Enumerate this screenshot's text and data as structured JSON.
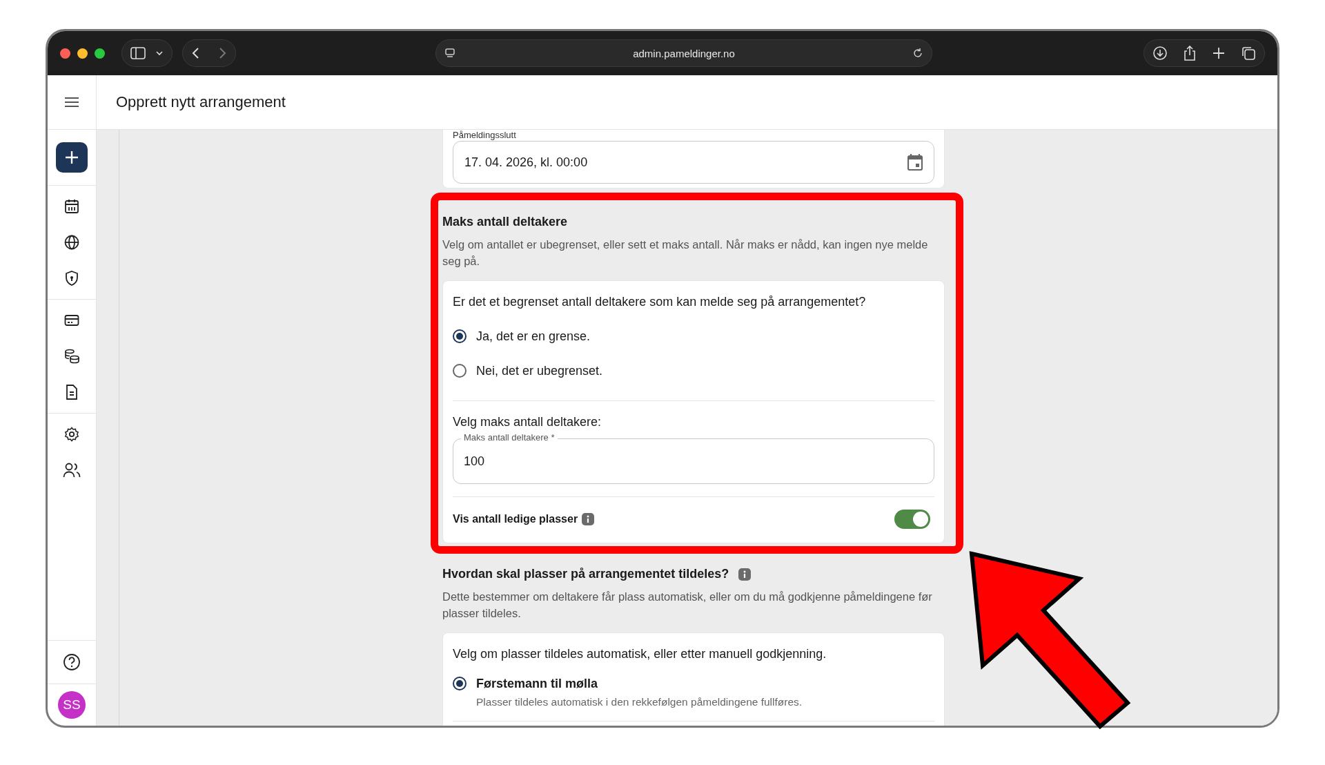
{
  "browser": {
    "url": "admin.pameldinger.no"
  },
  "header": {
    "title": "Opprett nytt arrangement"
  },
  "sidebar": {
    "avatar_initials": "SS"
  },
  "date_field": {
    "label": "Påmeldingsslutt",
    "value": "17. 04. 2026, kl. 00:00"
  },
  "max_section": {
    "title": "Maks antall deltakere",
    "description": "Velg om antallet er ubegrenset, eller sett et maks antall. Når maks er nådd, kan ingen nye melde seg på.",
    "question": "Er det et begrenset antall deltakere som kan melde seg på arrangementet?",
    "options": [
      {
        "label": "Ja, det er en grense.",
        "selected": true
      },
      {
        "label": "Nei, det er ubegrenset.",
        "selected": false
      }
    ],
    "max_prompt": "Velg maks antall deltakere:",
    "max_field": {
      "label": "Maks antall deltakere *",
      "value": "100"
    },
    "show_available": {
      "label": "Vis antall ledige plasser",
      "on": true
    }
  },
  "allocation_section": {
    "title": "Hvordan skal plasser på arrangementet tildeles?",
    "description": "Dette bestemmer om deltakere får plass automatisk, eller om du må godkjenne påmeldingene før plasser tildeles.",
    "question": "Velg om plasser tildeles automatisk, eller etter manuell godkjenning.",
    "options": [
      {
        "label": "Førstemann til mølla",
        "description": "Plasser tildeles automatisk i den rekkefølgen påmeldingene fullføres.",
        "selected": true
      }
    ]
  }
}
